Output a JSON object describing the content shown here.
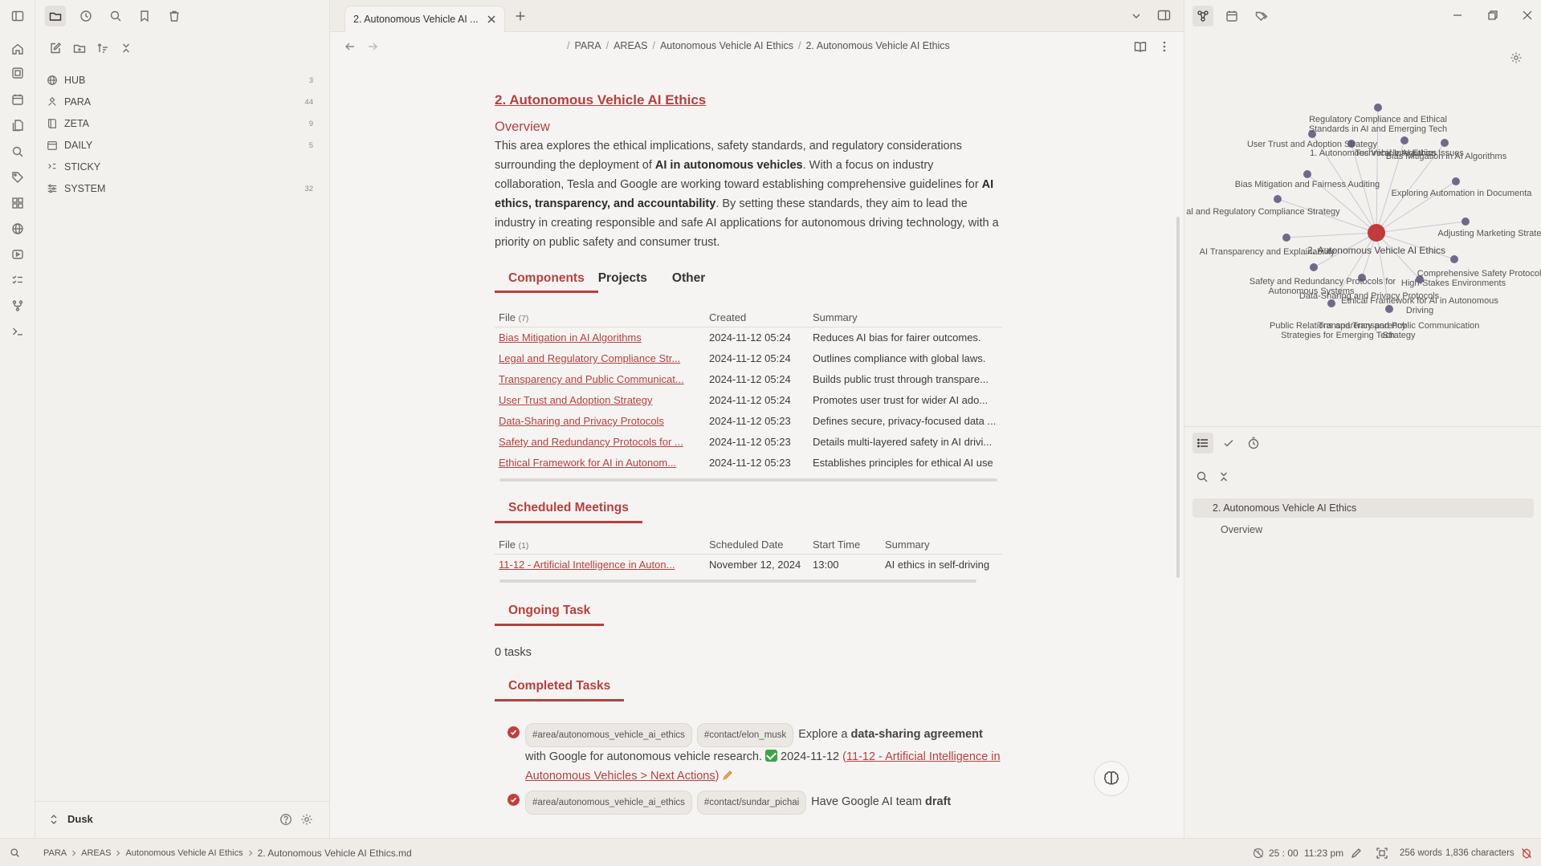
{
  "window": {
    "tab_title": "2. Autonomous Vehicle AI ...",
    "minimize_icon": "minimize-icon",
    "restore_icon": "restore-icon",
    "close_icon": "close-icon"
  },
  "ribbon": {
    "items": [
      "home-icon",
      "canvas-icon",
      "calendar-icon",
      "file-copy-icon",
      "search-icon",
      "tag-icon",
      "layout-icon",
      "globe-icon",
      "media-icon",
      "tasks-icon",
      "git-icon",
      "terminal-icon"
    ]
  },
  "left_sidebar": {
    "toolbar_icons": [
      "sidebar-toggle-icon",
      "folder-icon",
      "clock-icon",
      "search-icon",
      "bookmark-icon",
      "trash-icon"
    ],
    "action_icons": [
      "new-note-icon",
      "new-folder-icon",
      "sort-icon",
      "collapse-icon"
    ],
    "tree": [
      {
        "label": "HUB",
        "count": "3",
        "icon": "globe-icon"
      },
      {
        "label": "PARA",
        "count": "44",
        "icon": "para-icon"
      },
      {
        "label": "ZETA",
        "count": "9",
        "icon": "book-icon"
      },
      {
        "label": "DAILY",
        "count": "5",
        "icon": "calendar-icon"
      },
      {
        "label": "STICKY",
        "count": "",
        "icon": "sticky-icon"
      },
      {
        "label": "SYSTEM",
        "count": "32",
        "icon": "system-icon"
      }
    ],
    "vault_name": "Dusk"
  },
  "breadcrumb": {
    "sep": "/",
    "items": [
      "PARA",
      "AREAS",
      "Autonomous Vehicle AI Ethics",
      "2. Autonomous Vehicle AI Ethics"
    ]
  },
  "doc": {
    "title": "2. Autonomous Vehicle AI Ethics",
    "overview_heading": "Overview",
    "para_parts": {
      "p1": "This area explores the ethical implications, safety standards, and regulatory considerations surrounding the deployment of ",
      "b1": "AI in autonomous vehicles",
      "p2": ". With a focus on industry collaboration, Tesla and Google are working toward establishing comprehensive guidelines for ",
      "b2": "AI ethics, transparency, and accountability",
      "p3": ". By setting these standards, they aim to lead the industry in creating responsible and safe AI applications for autonomous driving technology, with a priority on public safety and consumer trust."
    },
    "subtabs": [
      "Components",
      "Projects",
      "Other"
    ],
    "components": {
      "headers": {
        "file": "File",
        "file_count": "(7)",
        "created": "Created",
        "summary": "Summary"
      },
      "rows": [
        {
          "file": "Bias Mitigation in AI Algorithms",
          "created": "2024-11-12 05:24",
          "summary": "Reduces AI bias for fairer outcomes."
        },
        {
          "file": "Legal and Regulatory Compliance Str...",
          "created": "2024-11-12 05:24",
          "summary": "Outlines compliance with global laws."
        },
        {
          "file": "Transparency and Public Communicat...",
          "created": "2024-11-12 05:24",
          "summary": "Builds public trust through transpare..."
        },
        {
          "file": "User Trust and Adoption Strategy",
          "created": "2024-11-12 05:24",
          "summary": "Promotes user trust for wider AI ado..."
        },
        {
          "file": "Data-Sharing and Privacy Protocols",
          "created": "2024-11-12 05:23",
          "summary": "Defines secure, privacy-focused data ..."
        },
        {
          "file": "Safety and Redundancy Protocols for ...",
          "created": "2024-11-12 05:23",
          "summary": "Details multi-layered safety in AI drivi..."
        },
        {
          "file": "Ethical Framework for AI in Autonom...",
          "created": "2024-11-12 05:23",
          "summary": "Establishes principles for ethical AI use"
        }
      ]
    },
    "meetings": {
      "heading": "Scheduled Meetings",
      "headers": {
        "file": "File",
        "file_count": "(1)",
        "date": "Scheduled Date",
        "time": "Start Time",
        "summary": "Summary"
      },
      "rows": [
        {
          "file": "11-12 - Artificial Intelligence in Auton...",
          "date": "November 12, 2024",
          "time": "13:00",
          "summary": "AI ethics in self-driving"
        }
      ]
    },
    "ongoing": {
      "heading": "Ongoing Task",
      "count_text": "0 tasks"
    },
    "completed": {
      "heading": "Completed Tasks",
      "task1": {
        "tag1": "#area/autonomous_vehicle_ai_ethics",
        "tag2": "#contact/elon_musk",
        "t1": "Explore a ",
        "b1": "data-sharing agreement",
        "t2": " with Google for autonomous vehicle research. ",
        "date": "2024-11-12",
        "link_open": "(",
        "link": "11-12 - Artificial Intelligence in Autonomous Vehicles > Next Actions",
        "link_close": ")"
      },
      "task2": {
        "tag1": "#area/autonomous_vehicle_ai_ethics",
        "tag2": "#contact/sundar_pichai",
        "t1": "Have Google AI team ",
        "b1": "draft"
      }
    }
  },
  "graph": {
    "center_label": "2. Autonomous Vehicle AI Ethics",
    "labels": [
      "Regulatory Compliance and Ethical",
      "Standards in AI and Emerging Tech",
      "User Trust and Adoption Strategy",
      "1. Autonomous Vehicle AI Ethics",
      "Technical Integration Issues",
      "Bias Mitigation in AI Algorithms",
      "Bias Mitigation and Fairness Auditing",
      "Exploring Automation in Documenta",
      "al and Regulatory Compliance Strategy",
      "Adjusting Marketing Strateg",
      "AI Transparency and Explainability",
      "Comprehensive Safety Protocols fo",
      "High-Stakes Environments",
      "Safety and Redundancy Protocols for",
      "Autonomous Systems",
      "Data-Sharing and Privacy Protocols",
      "Ethical Framework for AI in Autonomous",
      "Driving",
      "Public Relations and Transparency",
      "Strategies for Emerging Tech",
      "Transparency and Public Communication",
      "Strategy"
    ],
    "colors": {
      "node": "#6e6a8a",
      "center": "#c23a3a",
      "edge": "#c9c6d4"
    }
  },
  "outline": {
    "tab_icons": [
      "list-icon",
      "check-icon",
      "timer-icon"
    ],
    "items": [
      "2. Autonomous Vehicle AI Ethics",
      "Overview"
    ]
  },
  "statusbar": {
    "path": [
      "PARA",
      "AREAS",
      "Autonomous Vehicle AI Ethics",
      "2. Autonomous Vehicle AI Ethics.md"
    ],
    "timer": "25 : 00",
    "time": "11:23 pm",
    "words": "256 words",
    "chars": "1,836 characters"
  }
}
